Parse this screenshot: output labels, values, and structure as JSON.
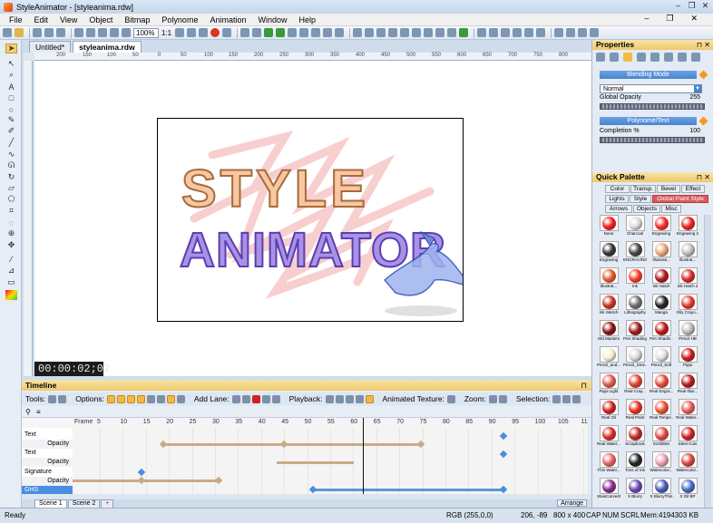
{
  "window": {
    "title": "StyleAnimator - [styleanima.rdw]",
    "controls": [
      "–",
      "❐",
      "✕"
    ],
    "menu_controls": [
      "–",
      "❐",
      "✕"
    ]
  },
  "menu": [
    "File",
    "Edit",
    "View",
    "Object",
    "Bitmap",
    "Polynome",
    "Animation",
    "Window",
    "Help"
  ],
  "toolbar": {
    "zoom": "100%",
    "ratio": "1:1"
  },
  "doc_tabs": [
    {
      "label": "Untitled*",
      "active": false
    },
    {
      "label": "styleanima.rdw",
      "active": true
    }
  ],
  "ruler": {
    "labels": [
      "200",
      "150",
      "100",
      "50",
      "0",
      "50",
      "100",
      "150",
      "200",
      "250",
      "300",
      "350",
      "400",
      "450",
      "500",
      "550",
      "600",
      "650",
      "700",
      "750",
      "800"
    ]
  },
  "canvas": {
    "text_line1": "STYLE",
    "text_line2": "ANIMATOR",
    "timecode": "00:00:02;02"
  },
  "timeline": {
    "title": "Timeline",
    "pin": "⊓",
    "tools_label": "Tools:",
    "options_label": "Options:",
    "add_lane_label": "Add Lane:",
    "playback_label": "Playback:",
    "animated_texture_label": "Animated Texture:",
    "zoom_label": "Zoom:",
    "selection_label": "Selection:",
    "frame_label": "Frame",
    "frame_ticks": [
      "5",
      "10",
      "15",
      "20",
      "25",
      "30",
      "35",
      "40",
      "45",
      "50",
      "55",
      "60",
      "65",
      "70",
      "75",
      "80",
      "85",
      "90",
      "95",
      "100",
      "105",
      "110"
    ],
    "playhead_frame": 62,
    "tracks": [
      "Text",
      "Opacity",
      "Text",
      "Opacity",
      "Signature",
      "Opacity",
      "GHS"
    ],
    "scenes": [
      "Scene 1",
      "Scene 2"
    ],
    "scene_add": "+",
    "arrange": "Arrange"
  },
  "properties": {
    "title": "Properties",
    "controls": "⊓ ✕",
    "blending_header": "Blending Mode",
    "blend_value": "Normal",
    "opacity_label": "Global Opacity",
    "opacity_value": "255",
    "polynome_header": "Polynome/Text",
    "completion_label": "Completion %",
    "completion_value": "100"
  },
  "palette": {
    "title": "Quick Palette",
    "controls": "⊓ ✕",
    "tabs_row1": [
      "Color",
      "Transp.",
      "Bevel",
      "Effect"
    ],
    "tabs_row2": [
      "Lights",
      "Style",
      "Global Paint Style"
    ],
    "tabs_row3": [
      "Arrows",
      "Objects",
      "Misc"
    ],
    "items": [
      {
        "label": "None",
        "color": "#ff1a1a"
      },
      {
        "label": "Charcoal",
        "color": "#dddddd"
      },
      {
        "label": "Engraving",
        "color": "#ff2a2a"
      },
      {
        "label": "Engraving 2",
        "color": "#f02020"
      },
      {
        "label": "Engraving",
        "color": "#333333"
      },
      {
        "label": "ENGRAVING",
        "color": "#444444"
      },
      {
        "label": "Illustrati...",
        "color": "#f0a878"
      },
      {
        "label": "Illustrat...",
        "color": "#c0c0c0"
      },
      {
        "label": "Illustrat...",
        "color": "#e85a28"
      },
      {
        "label": "Ink",
        "color": "#ff3a2a"
      },
      {
        "label": "Ink Hatch",
        "color": "#b01818"
      },
      {
        "label": "Ink Hatch 2",
        "color": "#d82a2a"
      },
      {
        "label": "Ink Sketch",
        "color": "#d03020"
      },
      {
        "label": "Lithography",
        "color": "#707070"
      },
      {
        "label": "Manga",
        "color": "#222222"
      },
      {
        "label": "Oily Crayo...",
        "color": "#e83a2a"
      },
      {
        "label": "Old Masters",
        "color": "#8a1010"
      },
      {
        "label": "Pen Shading",
        "color": "#a01a1a"
      },
      {
        "label": "Pen Shadin...",
        "color": "#c01818"
      },
      {
        "label": "Pencil HB",
        "color": "#bbbbbb"
      },
      {
        "label": "Pencil_and...",
        "color": "#f6efcf"
      },
      {
        "label": "Pencil_Sme...",
        "color": "#d8d8d8"
      },
      {
        "label": "Pencil_Soft",
        "color": "#e0e0e0"
      },
      {
        "label": "Pippi",
        "color": "#c81a1a"
      },
      {
        "label": "Pippi Light",
        "color": "#e65a4a"
      },
      {
        "label": "Real Cray...",
        "color": "#e84030"
      },
      {
        "label": "Real Engra...",
        "color": "#f04838"
      },
      {
        "label": "Real Illus...",
        "color": "#b81818"
      },
      {
        "label": "Real Oil",
        "color": "#d82020"
      },
      {
        "label": "Real Paint",
        "color": "#e83020"
      },
      {
        "label": "Real Tempe...",
        "color": "#f05030"
      },
      {
        "label": "Real Water...",
        "color": "#e85a5a"
      },
      {
        "label": "Real Water...",
        "color": "#e02828"
      },
      {
        "label": "Scrapbook",
        "color": "#c82828"
      },
      {
        "label": "Scribbles",
        "color": "#e84848"
      },
      {
        "label": "Steel Cuts",
        "color": "#cc2222"
      },
      {
        "label": "Thin Water...",
        "color": "#f06060"
      },
      {
        "label": "Tons of Ink",
        "color": "#222222"
      },
      {
        "label": "Watercolor...",
        "color": "#f0a0b0"
      },
      {
        "label": "Watercolor...",
        "color": "#e04040"
      },
      {
        "label": "StainCarvedIn",
        "color": "#8a2a8a"
      },
      {
        "label": "X Blurry",
        "color": "#6a4ab8"
      },
      {
        "label": "X BlurryThin",
        "color": "#4a5ab8"
      },
      {
        "label": "X Oil BP",
        "color": "#4a6ac8"
      }
    ]
  },
  "statusbar": {
    "left": "Ready",
    "rgb": "RGB (255,0,0)",
    "coords": "206, -89",
    "size": "800 x 400",
    "cap": "CAP",
    "num": "NUM",
    "scrl": "SCRL",
    "mem": "Mem:4194303 KB"
  },
  "colors": {
    "accent": "#4a8ee0",
    "panel_header": "#efc96a",
    "palette_active_tab": "#d85a5a",
    "keyframe_bar": "#c9ab87"
  }
}
